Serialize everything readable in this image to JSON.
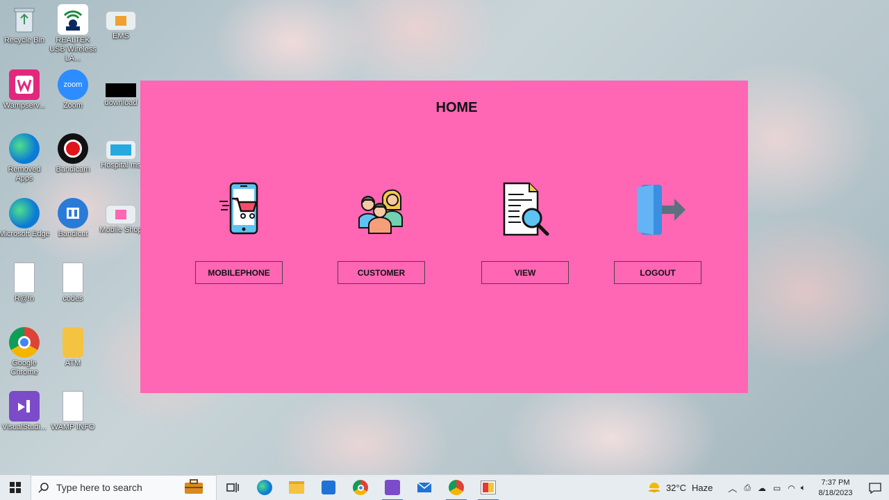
{
  "desktop": {
    "icons": [
      {
        "label": "Recycle Bin"
      },
      {
        "label": "REALTEK USB Wireless LA..."
      },
      {
        "label": "EMS"
      },
      {
        "label": "Wampserv..."
      },
      {
        "label": "Zoom"
      },
      {
        "label": "download"
      },
      {
        "label": "Removed Apps"
      },
      {
        "label": "Bandicam"
      },
      {
        "label": "Hospital ms"
      },
      {
        "label": "Microsoft Edge"
      },
      {
        "label": "Bandicut"
      },
      {
        "label": "Mobile Shop"
      },
      {
        "label": "R@!n"
      },
      {
        "label": "codes"
      },
      {
        "label": "Google Chrome"
      },
      {
        "label": "ATM"
      },
      {
        "label": "VisualStudi..."
      },
      {
        "label": "WAMP INFO"
      }
    ]
  },
  "app": {
    "title": "HOME",
    "menu": [
      {
        "label": "MOBILEPHONE",
        "icon": "mobile-cart-icon"
      },
      {
        "label": "CUSTOMER",
        "icon": "people-group-icon"
      },
      {
        "label": "VIEW",
        "icon": "document-search-icon"
      },
      {
        "label": "LOGOUT",
        "icon": "door-exit-icon"
      }
    ],
    "background_color": "#ff66b4"
  },
  "taskbar": {
    "search_placeholder": "Type here to search",
    "weather_temp": "32°C",
    "weather_desc": "Haze",
    "time": "7:37 PM",
    "date": "8/18/2023"
  }
}
